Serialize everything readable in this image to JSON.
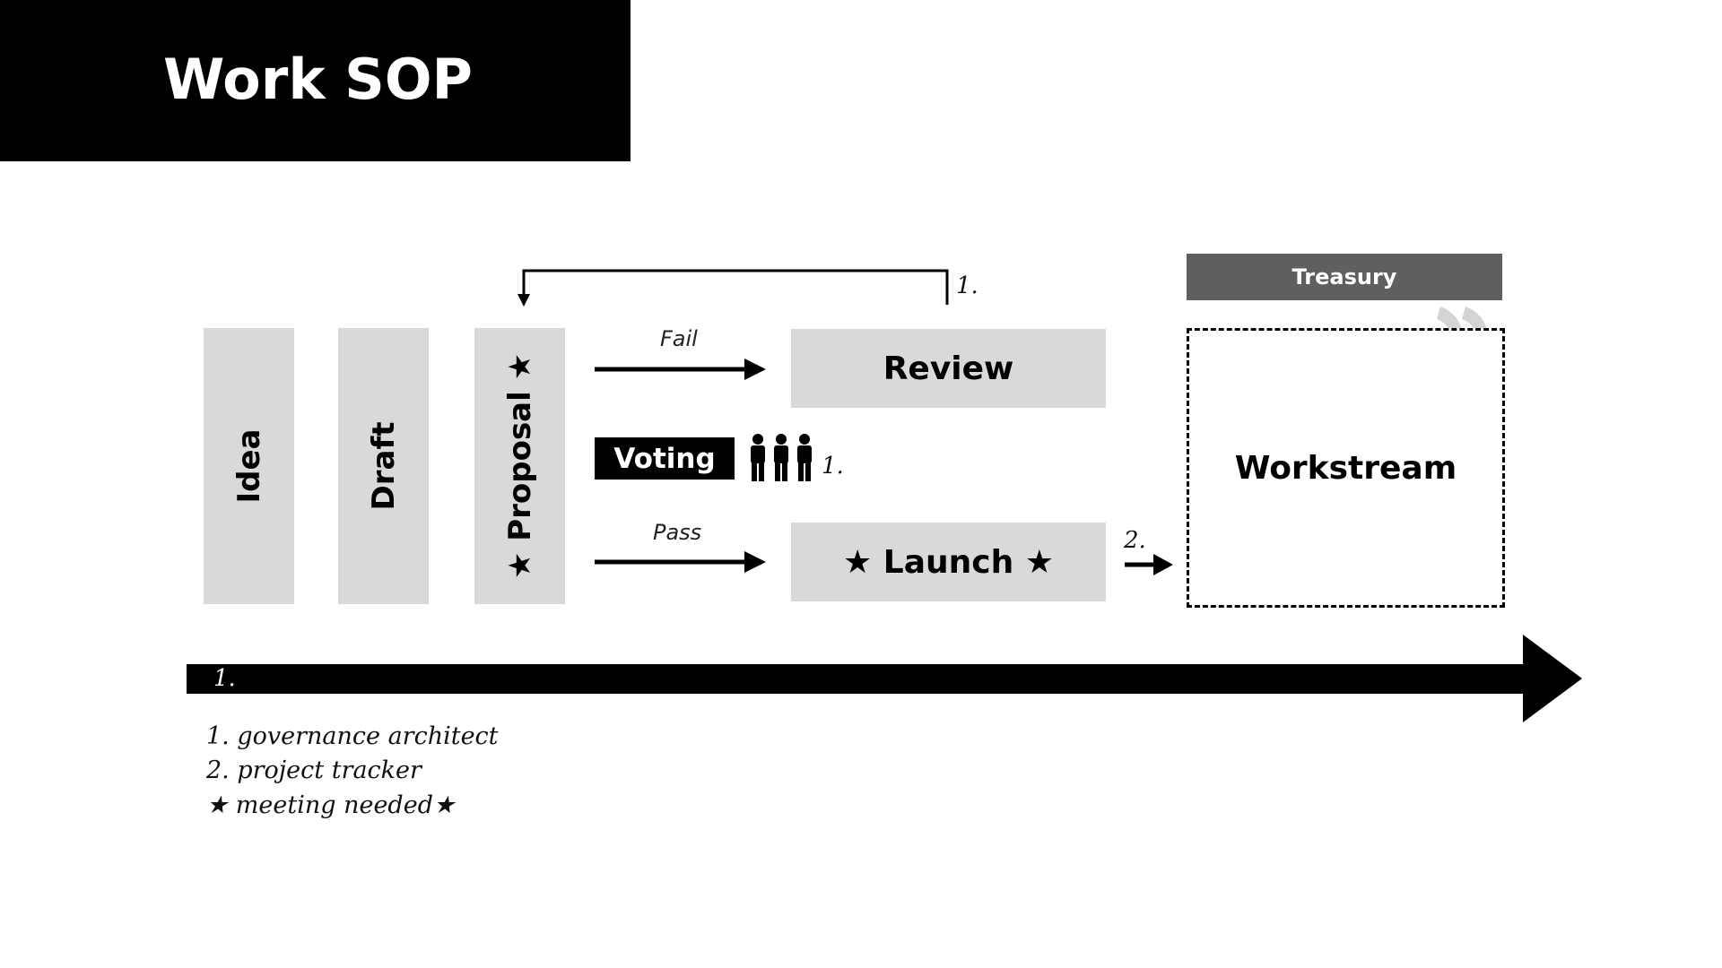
{
  "title": "Work SOP",
  "stages": {
    "idea": "Idea",
    "draft": "Draft",
    "proposal": "★ Proposal ★"
  },
  "flow": {
    "fail_label": "Fail",
    "pass_label": "Pass",
    "review": "Review",
    "voting": "Voting",
    "voting_note": "1.",
    "launch": "★ Launch ★",
    "launch_note": "2.",
    "loop_note": "1.",
    "timeline_note": "1."
  },
  "treasury": "Treasury",
  "workstream": "Workstream",
  "legend": [
    "1. governance architect",
    "2. project tracker",
    "★ meeting needed★"
  ],
  "icons": {
    "people": "three-people-icon",
    "refresh": "curved-arrows-icon"
  },
  "colors": {
    "title_bg": "#000000",
    "box_bg": "#d9d9d9",
    "treasury_bg": "#5f5f5f",
    "accent": "#000000"
  }
}
